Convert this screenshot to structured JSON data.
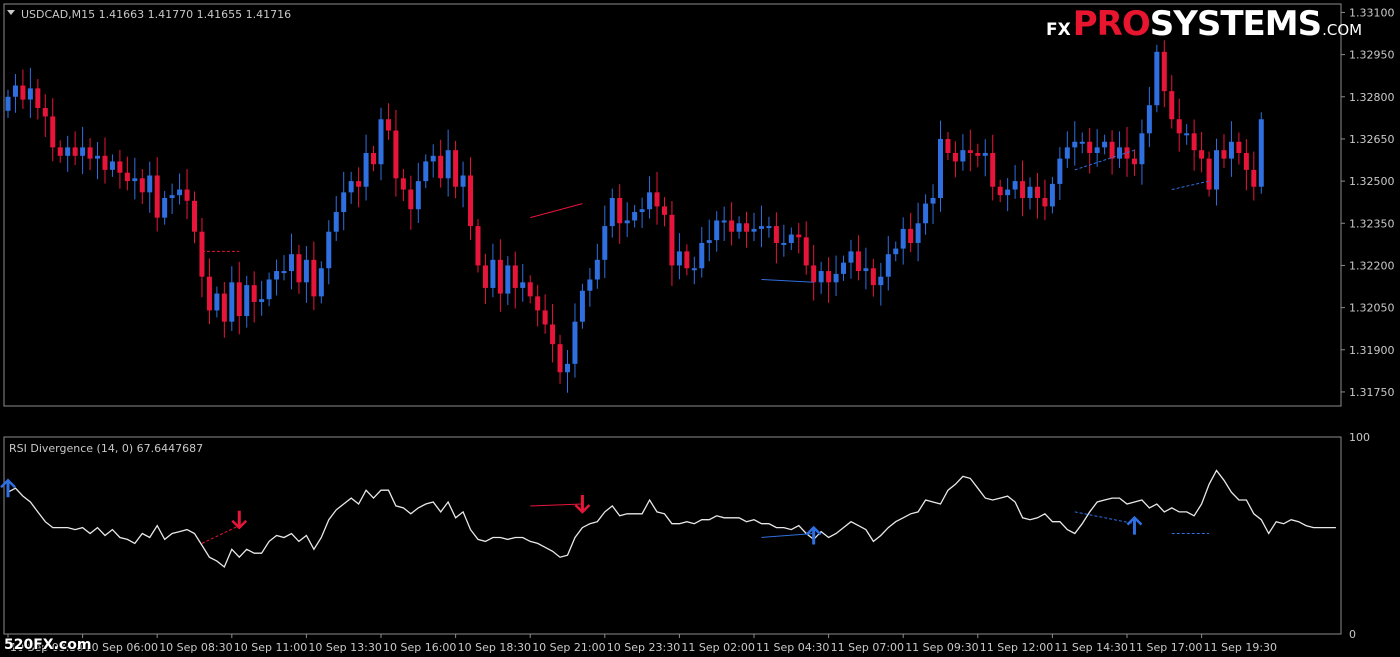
{
  "header": {
    "symbol_line": "USDCAD,M15  1.41663 1.41770 1.41655 1.41716",
    "indicator_line": "RSI Divergence (14, 0) 67.6447687"
  },
  "logo": {
    "fx": "FX",
    "pro": "PRO",
    "systems": "SYSTEMS",
    "com": ".COM"
  },
  "watermark": "520FX.com",
  "colors": {
    "bull": "#2f6fe0",
    "bear": "#e8153a",
    "rsi": "#e8e8e8",
    "frame": "#8c8c8c"
  },
  "chart_data": [
    {
      "type": "candlestick",
      "price_axis_ticks": [
        "1.33100",
        "1.32950",
        "1.32800",
        "1.32650",
        "1.32500",
        "1.32350",
        "1.32200",
        "1.32050",
        "1.31900",
        "1.31750"
      ],
      "ylim": [
        1.317,
        1.3313
      ],
      "x_ticks": [
        "10 Sep 03:30",
        "10 Sep 06:00",
        "10 Sep 08:30",
        "10 Sep 11:00",
        "10 Sep 13:30",
        "10 Sep 16:00",
        "10 Sep 18:30",
        "10 Sep 21:00",
        "10 Sep 23:30",
        "11 Sep 02:00",
        "11 Sep 04:30",
        "11 Sep 07:00",
        "11 Sep 09:30",
        "11 Sep 12:00",
        "11 Sep 14:30",
        "11 Sep 17:00",
        "11 Sep 19:30"
      ],
      "closes": [
        1.328,
        1.3284,
        1.3279,
        1.3283,
        1.3276,
        1.3273,
        1.3262,
        1.3259,
        1.3262,
        1.3259,
        1.3262,
        1.3258,
        1.3259,
        1.3254,
        1.3257,
        1.3253,
        1.325,
        1.3251,
        1.3246,
        1.3252,
        1.3237,
        1.3244,
        1.3245,
        1.3247,
        1.3243,
        1.3232,
        1.3216,
        1.3204,
        1.321,
        1.32,
        1.3214,
        1.3202,
        1.3213,
        1.3207,
        1.3208,
        1.3215,
        1.3218,
        1.3218,
        1.3224,
        1.3214,
        1.3222,
        1.3209,
        1.3219,
        1.3232,
        1.3239,
        1.3246,
        1.325,
        1.3248,
        1.326,
        1.3256,
        1.3272,
        1.3268,
        1.3251,
        1.3247,
        1.324,
        1.325,
        1.3257,
        1.3259,
        1.3251,
        1.3261,
        1.3248,
        1.3252,
        1.3234,
        1.322,
        1.3212,
        1.3222,
        1.321,
        1.322,
        1.3212,
        1.3214,
        1.3209,
        1.3204,
        1.3199,
        1.3192,
        1.3182,
        1.3185,
        1.32,
        1.3211,
        1.3215,
        1.3222,
        1.3234,
        1.3244,
        1.3235,
        1.3236,
        1.3239,
        1.324,
        1.3246,
        1.3241,
        1.3238,
        1.322,
        1.3225,
        1.3219,
        1.3219,
        1.3228,
        1.3229,
        1.3236,
        1.3236,
        1.3232,
        1.3235,
        1.3232,
        1.3233,
        1.3234,
        1.3234,
        1.3228,
        1.3228,
        1.3231,
        1.323,
        1.322,
        1.3214,
        1.3218,
        1.3214,
        1.3217,
        1.3221,
        1.3225,
        1.3218,
        1.3219,
        1.3213,
        1.3216,
        1.3224,
        1.3226,
        1.3233,
        1.3228,
        1.3235,
        1.3242,
        1.3244,
        1.3265,
        1.326,
        1.3257,
        1.3261,
        1.326,
        1.3259,
        1.326,
        1.3248,
        1.3245,
        1.3247,
        1.325,
        1.3244,
        1.3248,
        1.3244,
        1.3241,
        1.3249,
        1.3258,
        1.3262,
        1.3264,
        1.3264,
        1.326,
        1.3262,
        1.3264,
        1.3258,
        1.3262,
        1.3258,
        1.3256,
        1.3267,
        1.3277,
        1.3296,
        1.3282,
        1.3272,
        1.3267,
        1.3267,
        1.3261,
        1.3258,
        1.3247,
        1.3261,
        1.3258,
        1.3264,
        1.326,
        1.3254,
        1.3248,
        1.3272
      ],
      "divergence_lines": [
        {
          "color": "bear",
          "style": "dashed",
          "from": [
            "10 Sep 10:00",
            1.3225
          ],
          "to": [
            "10 Sep 11:15",
            1.3225
          ]
        },
        {
          "color": "bear",
          "style": "solid",
          "from": [
            "10 Sep 21:00",
            1.3237
          ],
          "to": [
            "10 Sep 22:45",
            1.3242
          ]
        },
        {
          "color": "bull",
          "style": "solid",
          "from": [
            "11 Sep 04:45",
            1.3215
          ],
          "to": [
            "11 Sep 06:30",
            1.3214
          ]
        },
        {
          "color": "bull",
          "style": "dashed",
          "from": [
            "11 Sep 15:15",
            1.3254
          ],
          "to": [
            "11 Sep 17:15",
            1.3261
          ]
        },
        {
          "color": "bull",
          "style": "dashed",
          "from": [
            "11 Sep 18:30",
            1.3247
          ],
          "to": [
            "11 Sep 19:45",
            1.325
          ]
        }
      ]
    },
    {
      "type": "line",
      "title": "RSI Divergence (14, 0) 67.6447687",
      "ylim": [
        0,
        100
      ],
      "y_ticks": [
        "100",
        "0"
      ],
      "series": [
        {
          "values": [
            72,
            74,
            70,
            67,
            62,
            57,
            54,
            54,
            54,
            53,
            54,
            51,
            54,
            50,
            53,
            49,
            48,
            46,
            51,
            49,
            55,
            48,
            51,
            52,
            53,
            51,
            45,
            39,
            37,
            34,
            43,
            39,
            43,
            41,
            41,
            47,
            50,
            49,
            51,
            47,
            50,
            43,
            49,
            58,
            63,
            66,
            69,
            66,
            73,
            69,
            73,
            73,
            65,
            64,
            61,
            64,
            66,
            67,
            62,
            67,
            59,
            62,
            53,
            48,
            47,
            49,
            49,
            48,
            49,
            49,
            47,
            46,
            44,
            42,
            39,
            40,
            49,
            54,
            56,
            57,
            62,
            65,
            60,
            61,
            61,
            61,
            68,
            62,
            61,
            56,
            56,
            57,
            56,
            58,
            58,
            60,
            59,
            59,
            59,
            57,
            58,
            56,
            56,
            54,
            54,
            53,
            55,
            51,
            48,
            52,
            49,
            51,
            54,
            57,
            55,
            53,
            47,
            50,
            54,
            57,
            59,
            61,
            62,
            68,
            67,
            66,
            73,
            76,
            80,
            79,
            74,
            69,
            68,
            69,
            70,
            67,
            59,
            58,
            59,
            61,
            57,
            57,
            53,
            51,
            56,
            62,
            67,
            68,
            69,
            69,
            66,
            67,
            68,
            64,
            66,
            62,
            64,
            62,
            62,
            60,
            66,
            76,
            83,
            78,
            72,
            68,
            68,
            61,
            58,
            51,
            57,
            56,
            58,
            57,
            55,
            54,
            54,
            54,
            54
          ]
        }
      ],
      "divergence_lines": [
        {
          "color": "bear",
          "style": "dashed",
          "from": [
            "10 Sep 10:00",
            46
          ],
          "to": [
            "10 Sep 11:15",
            55
          ]
        },
        {
          "color": "bear",
          "style": "solid",
          "from": [
            "10 Sep 21:00",
            65
          ],
          "to": [
            "10 Sep 22:45",
            66
          ]
        },
        {
          "color": "bull",
          "style": "solid",
          "from": [
            "11 Sep 04:45",
            49
          ],
          "to": [
            "11 Sep 06:30",
            51
          ]
        },
        {
          "color": "bull",
          "style": "dashed",
          "from": [
            "11 Sep 15:15",
            62
          ],
          "to": [
            "11 Sep 17:15",
            56
          ]
        },
        {
          "color": "bull",
          "style": "dashed",
          "from": [
            "11 Sep 18:30",
            51
          ],
          "to": [
            "11 Sep 19:45",
            51
          ]
        }
      ],
      "signals": [
        {
          "kind": "buy",
          "time": "10 Sep 03:30",
          "rsi": 74
        },
        {
          "kind": "sell",
          "time": "10 Sep 11:15",
          "rsi": 58
        },
        {
          "kind": "sell",
          "time": "10 Sep 22:45",
          "rsi": 66
        },
        {
          "kind": "buy",
          "time": "11 Sep 06:30",
          "rsi": 50
        },
        {
          "kind": "buy",
          "time": "11 Sep 17:15",
          "rsi": 55
        }
      ]
    }
  ]
}
